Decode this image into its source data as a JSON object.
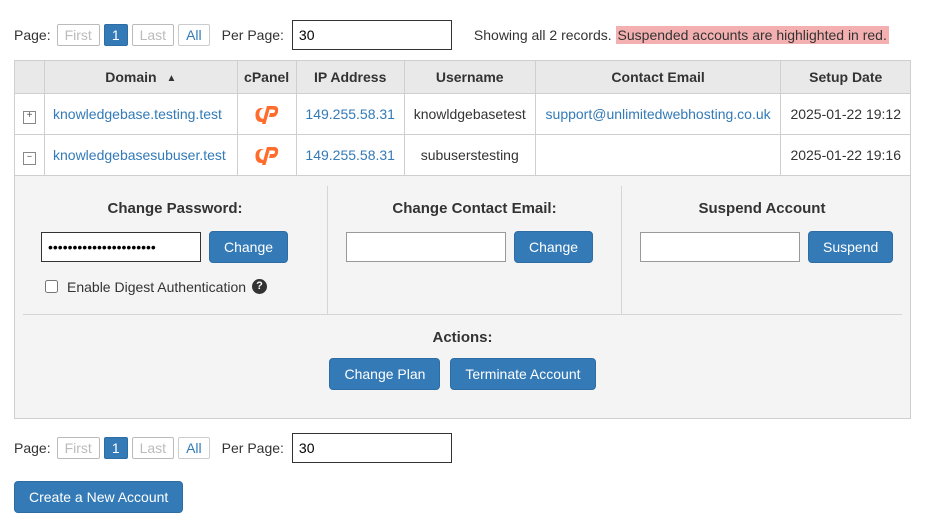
{
  "pager": {
    "page_label": "Page:",
    "first": "First",
    "current": "1",
    "last": "Last",
    "all": "All",
    "per_page_label": "Per Page:",
    "per_page_value": "30",
    "showing": "Showing all 2 records.",
    "note": "Suspended accounts are highlighted in red."
  },
  "columns": {
    "domain": "Domain",
    "cpanel": "cPanel",
    "ip": "IP Address",
    "username": "Username",
    "email": "Contact Email",
    "setup": "Setup Date"
  },
  "rows": [
    {
      "expand_glyph": "+",
      "domain": "knowledgebase.testing.test",
      "ip": "149.255.58.31",
      "username": "knowldgebasetest",
      "email": "support@unlimitedwebhosting.co.uk",
      "setup": "2025-01-22 19:12"
    },
    {
      "expand_glyph": "–",
      "domain": "knowledgebasesubuser.test",
      "ip": "149.255.58.31",
      "username": "subuserstesting",
      "email": "",
      "setup": "2025-01-22 19:16"
    }
  ],
  "panel": {
    "pw_title": "Change Password:",
    "pw_value": "••••••••••••••••••••••",
    "pw_btn": "Change",
    "digest_label": "Enable Digest Authentication",
    "email_title": "Change Contact Email:",
    "email_btn": "Change",
    "susp_title": "Suspend Account",
    "susp_btn": "Suspend",
    "actions_title": "Actions:",
    "change_plan_btn": "Change Plan",
    "terminate_btn": "Terminate Account"
  },
  "create_btn": "Create a New Account"
}
